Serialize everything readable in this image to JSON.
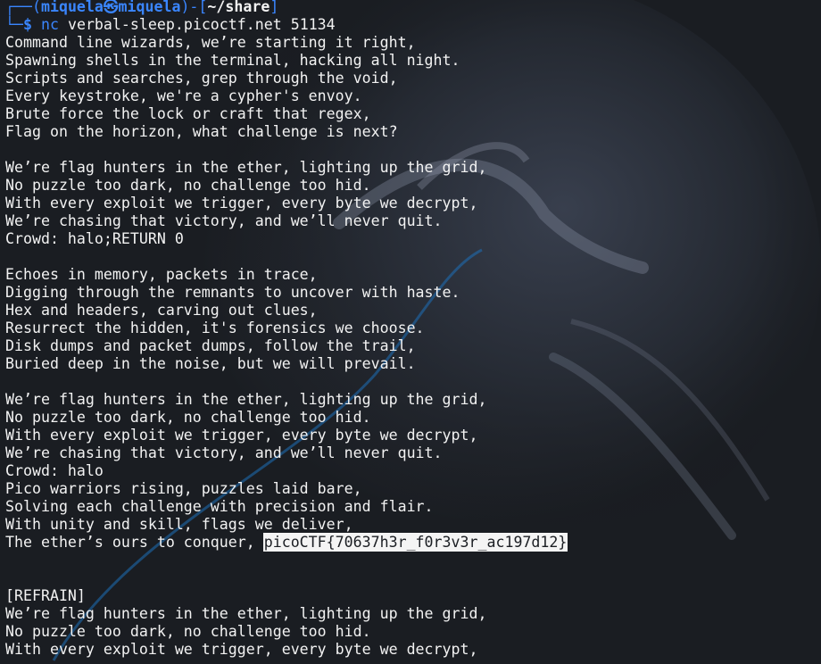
{
  "colors": {
    "prompt_blue": "#3a86ff",
    "background": "#1b1e23",
    "text": "#f2f2f2",
    "selection": "#f4f4f4"
  },
  "prompt": {
    "frame_top_left": "┌──(",
    "user": "miquela",
    "at_symbol": "㉿",
    "host": "miquela",
    "frame_mid": ")-[",
    "path": "~/share",
    "frame_close": "]",
    "frame_bottom": "└─",
    "dollar": "$",
    "command": "nc",
    "args": " verbal-sleep.picoctf.net 51134"
  },
  "output": {
    "lines": [
      "Command line wizards, we’re starting it right,",
      "Spawning shells in the terminal, hacking all night.",
      "Scripts and searches, grep through the void,",
      "Every keystroke, we're a cypher's envoy.",
      "Brute force the lock or craft that regex,",
      "Flag on the horizon, what challenge is next?",
      "",
      "We’re flag hunters in the ether, lighting up the grid,",
      "No puzzle too dark, no challenge too hid.",
      "With every exploit we trigger, every byte we decrypt,",
      "We’re chasing that victory, and we’ll never quit.",
      "Crowd: halo;RETURN 0",
      "",
      "Echoes in memory, packets in trace,",
      "Digging through the remnants to uncover with haste.",
      "Hex and headers, carving out clues,",
      "Resurrect the hidden, it's forensics we choose.",
      "Disk dumps and packet dumps, follow the trail,",
      "Buried deep in the noise, but we will prevail.",
      "",
      "We’re flag hunters in the ether, lighting up the grid,",
      "No puzzle too dark, no challenge too hid.",
      "With every exploit we trigger, every byte we decrypt,",
      "We’re chasing that victory, and we’ll never quit.",
      "Crowd: halo",
      "Pico warriors rising, puzzles laid bare,",
      "Solving each challenge with precision and flair.",
      "With unity and skill, flags we deliver,"
    ],
    "flag_line_prefix": "The ether’s ours to conquer, ",
    "flag": "picoCTF{70637h3r_f0r3v3r_ac197d12}",
    "after_flag": [
      "",
      "",
      "[REFRAIN]",
      "We’re flag hunters in the ether, lighting up the grid,",
      "No puzzle too dark, no challenge too hid.",
      "With every exploit we trigger, every byte we decrypt,"
    ]
  }
}
